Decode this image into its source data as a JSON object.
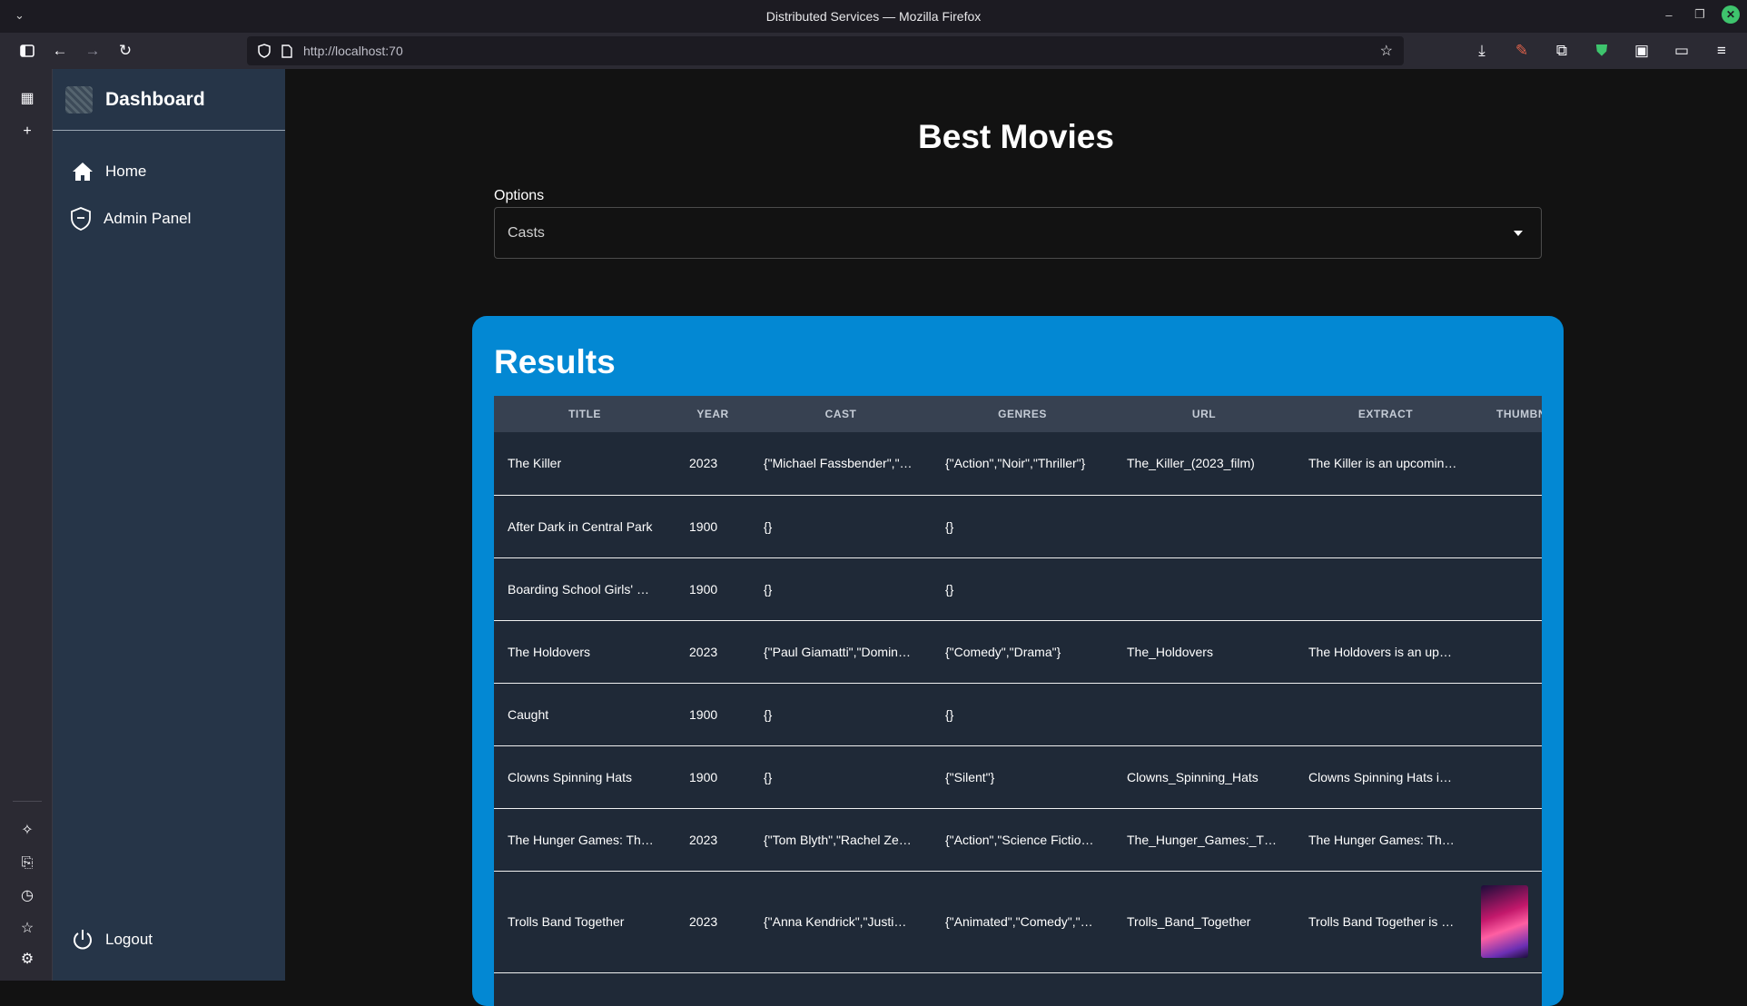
{
  "browser": {
    "window_title": "Distributed Services — Mozilla Firefox",
    "url": "http://localhost:70"
  },
  "sidebar": {
    "brand": "Dashboard",
    "items": [
      {
        "label": "Home",
        "icon": "home-icon"
      },
      {
        "label": "Admin Panel",
        "icon": "shield-icon"
      }
    ],
    "logout": "Logout"
  },
  "main": {
    "title": "Best Movies",
    "options_label": "Options",
    "options_value": "Casts",
    "results_title": "Results"
  },
  "table": {
    "columns": [
      "TITLE",
      "YEAR",
      "CAST",
      "GENRES",
      "URL",
      "EXTRACT",
      "THUMBNAIL"
    ],
    "rows": [
      {
        "title": "The Killer",
        "year": "2023",
        "cast": "{\"Michael Fassbender\",\"…",
        "genres": "{\"Action\",\"Noir\",\"Thriller\"}",
        "url": "The_Killer_(2023_film)",
        "extract": "The Killer is an upcomin…",
        "thumbnail": false
      },
      {
        "title": "After Dark in Central Park",
        "year": "1900",
        "cast": "{}",
        "genres": "{}",
        "url": "",
        "extract": "",
        "thumbnail": false
      },
      {
        "title": "Boarding School Girls' …",
        "year": "1900",
        "cast": "{}",
        "genres": "{}",
        "url": "",
        "extract": "",
        "thumbnail": false
      },
      {
        "title": "The Holdovers",
        "year": "2023",
        "cast": "{\"Paul Giamatti\",\"Domin…",
        "genres": "{\"Comedy\",\"Drama\"}",
        "url": "The_Holdovers",
        "extract": "The Holdovers is an up…",
        "thumbnail": false
      },
      {
        "title": "Caught",
        "year": "1900",
        "cast": "{}",
        "genres": "{}",
        "url": "",
        "extract": "",
        "thumbnail": false
      },
      {
        "title": "Clowns Spinning Hats",
        "year": "1900",
        "cast": "{}",
        "genres": "{\"Silent\"}",
        "url": "Clowns_Spinning_Hats",
        "extract": "Clowns Spinning Hats i…",
        "thumbnail": false
      },
      {
        "title": "The Hunger Games: Th…",
        "year": "2023",
        "cast": "{\"Tom Blyth\",\"Rachel Ze…",
        "genres": "{\"Action\",\"Science Fictio…",
        "url": "The_Hunger_Games:_T…",
        "extract": "The Hunger Games: Th…",
        "thumbnail": false
      },
      {
        "title": "Trolls Band Together",
        "year": "2023",
        "cast": "{\"Anna Kendrick\",\"Justi…",
        "genres": "{\"Animated\",\"Comedy\",\"…",
        "url": "Trolls_Band_Together",
        "extract": "Trolls Band Together is …",
        "thumbnail": true
      }
    ]
  },
  "colors": {
    "results_panel": "#0388d3",
    "sidebar": "#263548",
    "table_row": "#1f2937",
    "table_header": "#374151"
  }
}
